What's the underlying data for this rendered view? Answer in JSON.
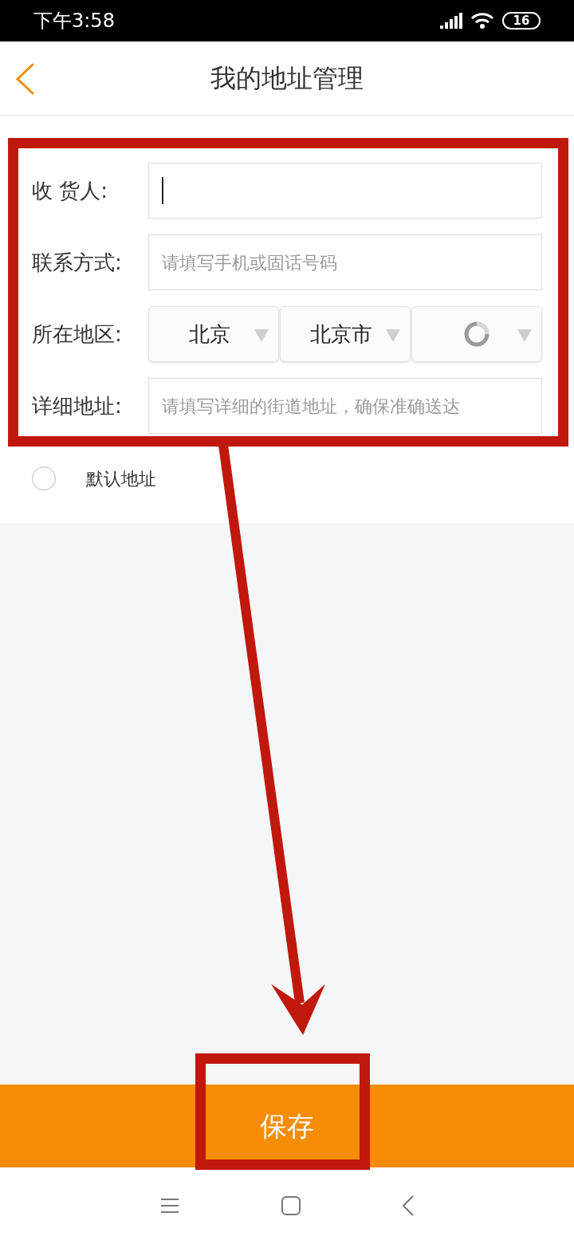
{
  "status_bar": {
    "time": "下午3:58",
    "battery": "16"
  },
  "header": {
    "title": "我的地址管理"
  },
  "form": {
    "fields": [
      {
        "kind": "input",
        "label": "收 货人:",
        "focused": true
      },
      {
        "kind": "input",
        "label": "联系方式:",
        "placeholder": "请填写手机或固话号码",
        "focused": false
      },
      {
        "kind": "region",
        "label": "所在地区:",
        "selects": [
          {
            "value": "北京",
            "loading": false
          },
          {
            "value": "北京市",
            "loading": false
          },
          {
            "loading": true
          }
        ]
      },
      {
        "kind": "input",
        "label": "详细地址:",
        "placeholder": "请填写详细的街道地址，确保准确送达",
        "focused": false
      }
    ]
  },
  "default_address": {
    "label": "默认地址",
    "checked": false
  },
  "save_button": {
    "label": "保存"
  },
  "annotations": [
    {
      "kind": "box"
    },
    {
      "kind": "arrow"
    },
    {
      "kind": "box"
    }
  ]
}
